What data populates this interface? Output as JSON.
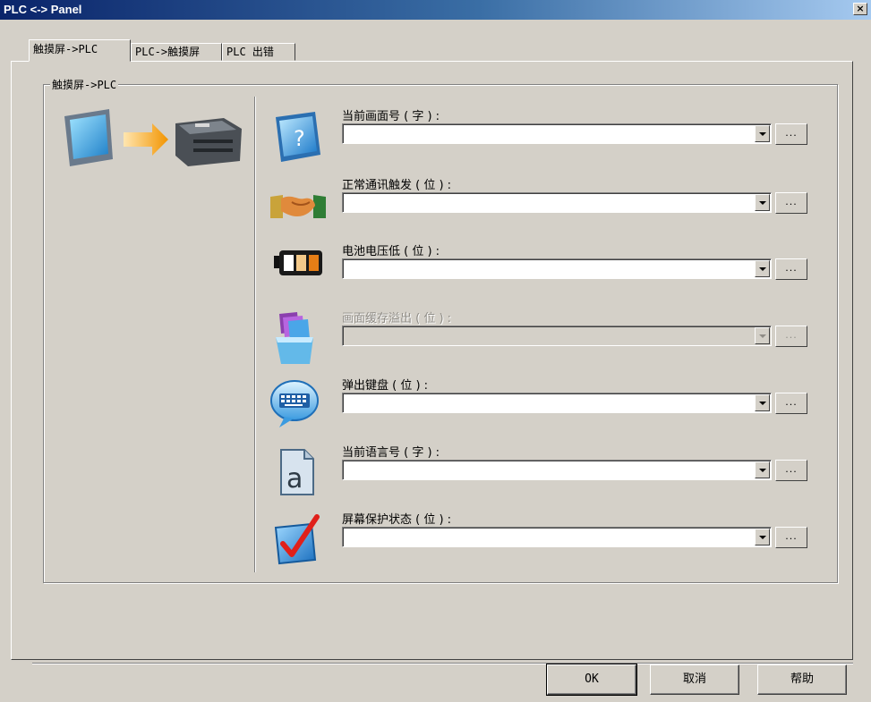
{
  "window": {
    "title": "PLC <-> Panel",
    "close_glyph": "×"
  },
  "tabs": [
    {
      "label": "触摸屏->PLC",
      "active": true
    },
    {
      "label": "PLC->触摸屏",
      "active": false
    },
    {
      "label": "PLC 出错",
      "active": false
    }
  ],
  "group": {
    "legend": "触摸屏->PLC"
  },
  "fields": [
    {
      "label": "当前画面号 ( 字 ) :",
      "value": "",
      "browse": "...",
      "icon": "question-monitor-icon",
      "enabled": true
    },
    {
      "label": "正常通讯触发 ( 位 ) :",
      "value": "",
      "browse": "...",
      "icon": "handshake-icon",
      "enabled": true
    },
    {
      "label": "电池电压低 ( 位 ) :",
      "value": "",
      "browse": "...",
      "icon": "battery-icon",
      "enabled": true
    },
    {
      "label": "画面缓存溢出 ( 位 ) :",
      "value": "",
      "browse": "...",
      "icon": "stacked-bucket-icon",
      "enabled": false
    },
    {
      "label": "弹出键盘 ( 位 ) :",
      "value": "",
      "browse": "...",
      "icon": "keyboard-bubble-icon",
      "enabled": true
    },
    {
      "label": "当前语言号 ( 字 ) :",
      "value": "",
      "browse": "...",
      "icon": "language-document-icon",
      "enabled": true
    },
    {
      "label": "屏幕保护状态 ( 位 ) :",
      "value": "",
      "browse": "...",
      "icon": "checkmark-box-icon",
      "enabled": true
    }
  ],
  "buttons": {
    "ok": "OK",
    "cancel": "取消",
    "help": "帮助"
  },
  "colors": {
    "titlebar_start": "#0a246a",
    "titlebar_end": "#a6caf0",
    "face": "#d4d0c8"
  }
}
